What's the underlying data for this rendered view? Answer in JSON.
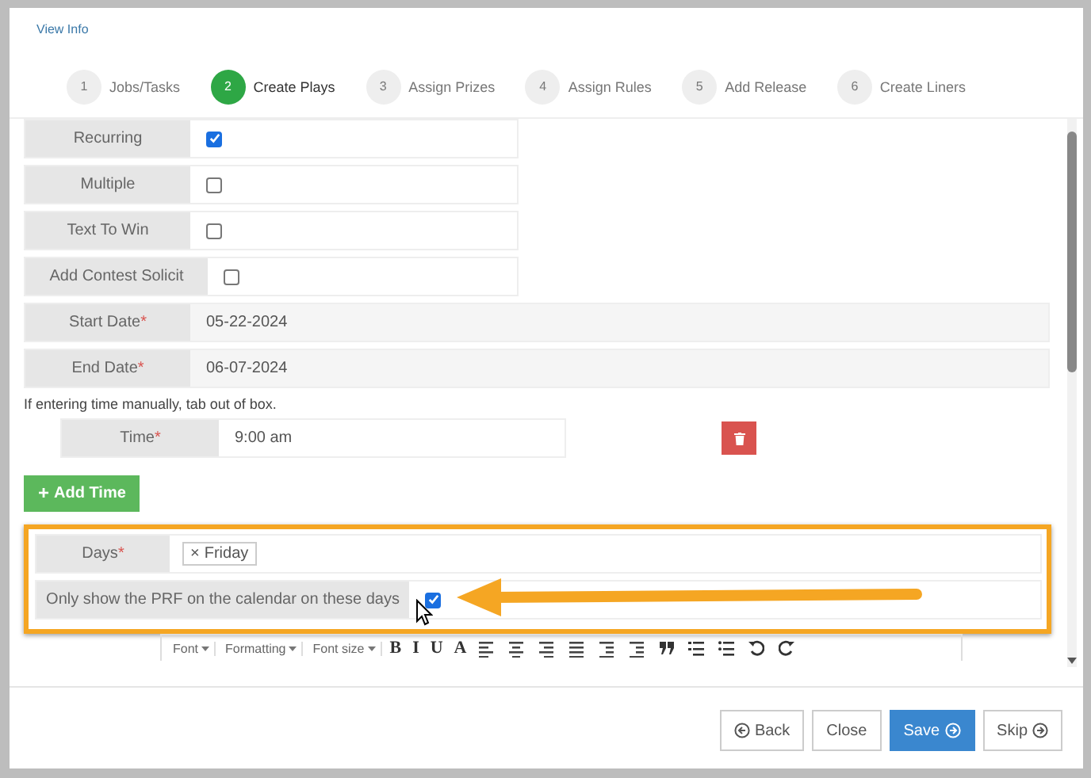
{
  "view_info": "View Info",
  "steps": [
    {
      "number": "1",
      "label": "Jobs/Tasks",
      "selected": false
    },
    {
      "number": "2",
      "label": "Create Plays",
      "selected": true
    },
    {
      "number": "3",
      "label": "Assign Prizes",
      "selected": false
    },
    {
      "number": "4",
      "label": "Assign Rules",
      "selected": false
    },
    {
      "number": "5",
      "label": "Add Release",
      "selected": false
    },
    {
      "number": "6",
      "label": "Create Liners",
      "selected": false
    }
  ],
  "options": [
    {
      "label": "Recurring",
      "checked": true
    },
    {
      "label": "Multiple",
      "checked": false
    },
    {
      "label": "Text To Win",
      "checked": false
    },
    {
      "label": "Add Contest Solicit",
      "checked": false
    }
  ],
  "dates": [
    {
      "label": "Start Date",
      "required_mark": "*",
      "value": "05-22-2024"
    },
    {
      "label": "End Date",
      "required_mark": "*",
      "value": "06-07-2024"
    }
  ],
  "time_hint": "If entering time manually, tab out of box.",
  "time": {
    "label": "Time",
    "required_mark": "*",
    "value": "9:00 am"
  },
  "add_time": {
    "icon": "+",
    "label": "Add Time"
  },
  "days": {
    "label": "Days",
    "required_mark": "*",
    "tags": [
      {
        "remove": "×",
        "label": "Friday"
      }
    ]
  },
  "calendar_only": {
    "label": "Only show the PRF on the calendar on these days",
    "checked": true
  },
  "editor_toolbar": [
    {
      "kind": "dropdown",
      "label": "Font"
    },
    {
      "kind": "dropdown",
      "label": "Formatting"
    },
    {
      "kind": "dropdown",
      "label": "Font size"
    },
    {
      "kind": "text",
      "label": "B"
    },
    {
      "kind": "text",
      "label": "I"
    },
    {
      "kind": "text",
      "label": "U"
    },
    {
      "kind": "text",
      "label": "A"
    }
  ],
  "buttons": [
    {
      "kind": "back",
      "label": "Back",
      "primary": false
    },
    {
      "kind": "plain",
      "label": "Close",
      "primary": false
    },
    {
      "kind": "next",
      "label": "Save",
      "primary": true
    },
    {
      "kind": "next",
      "label": "Skip",
      "primary": false
    }
  ]
}
